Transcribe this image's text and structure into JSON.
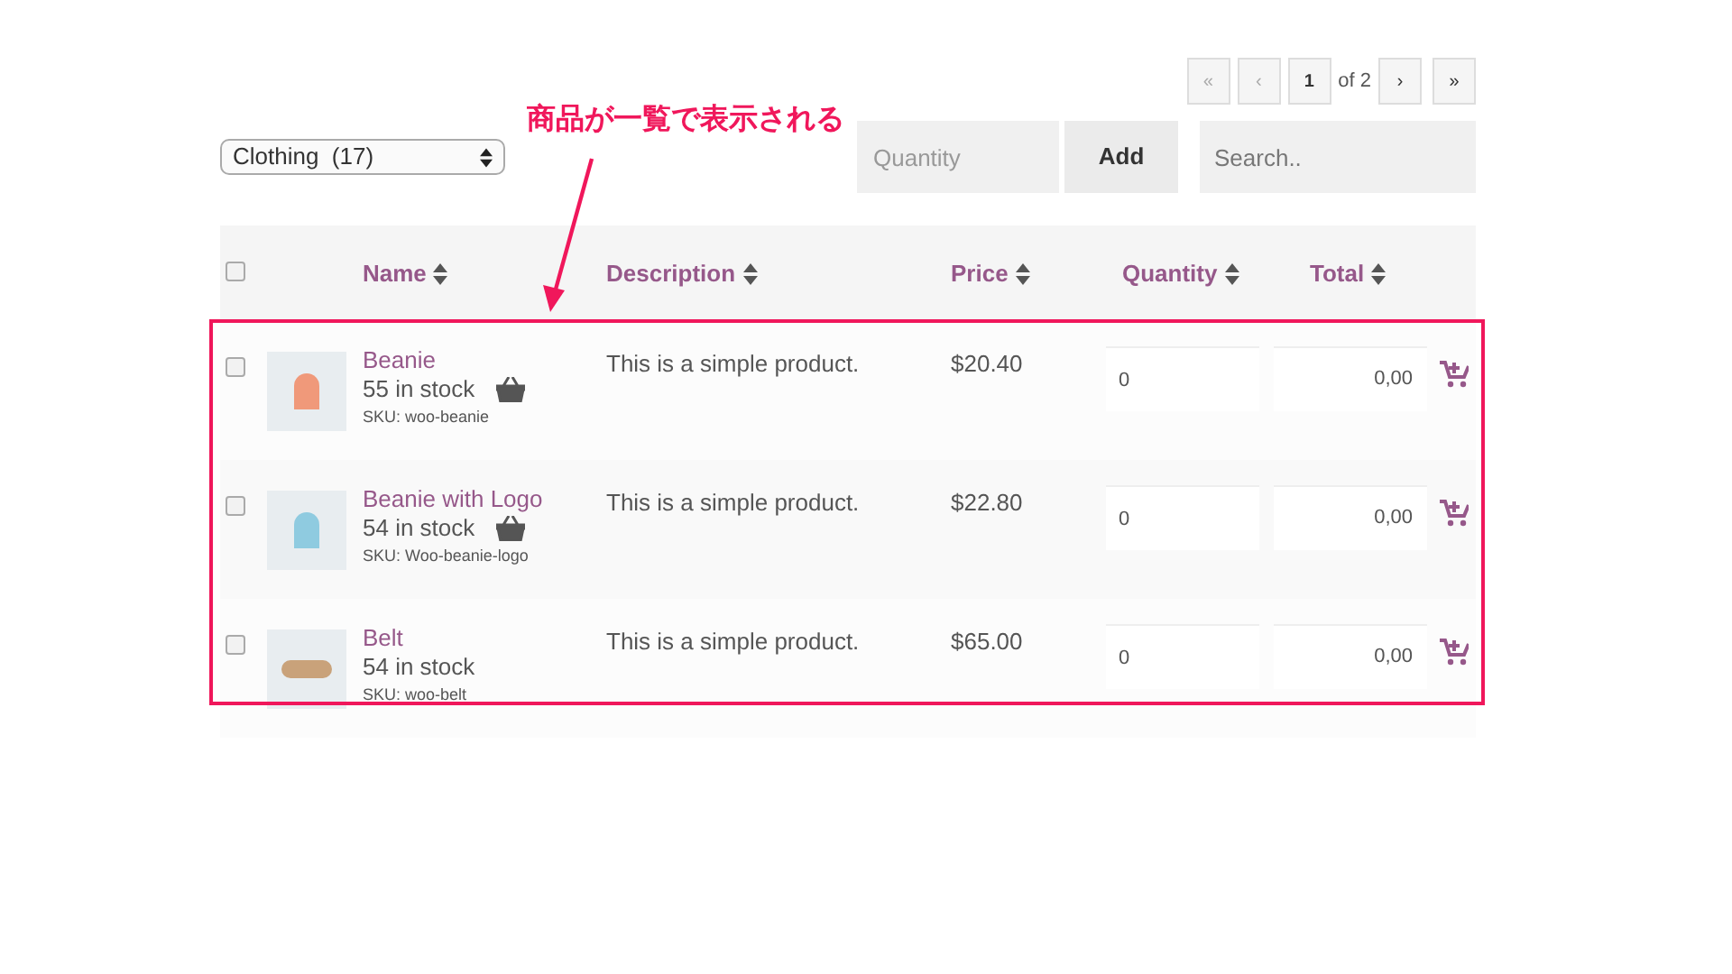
{
  "pagination": {
    "first": "«",
    "prev": "‹",
    "page": "1",
    "of": "of 2",
    "next": "›",
    "last": "»"
  },
  "category_select": {
    "value": "Clothing  (17)"
  },
  "quantity_field": {
    "placeholder": "Quantity"
  },
  "add_button": "Add",
  "search": {
    "placeholder": "Search.."
  },
  "table": {
    "select_all": {
      "checked": false
    },
    "columns": [
      "Name",
      "Description",
      "Price",
      "Quantity",
      "Total"
    ],
    "rows": [
      {
        "checked": false,
        "name": "Beanie",
        "stock": "55 in stock",
        "basket": true,
        "sku": "SKU: woo-beanie",
        "description": "This is a simple product.",
        "price": "$20.40",
        "quantity": "0",
        "total": "0,00",
        "kind": "beanie"
      },
      {
        "checked": false,
        "name": "Beanie with Logo",
        "stock": "54 in stock",
        "basket": true,
        "sku": "SKU: Woo-beanie-logo",
        "description": "This is a simple product.",
        "price": "$22.80",
        "quantity": "0",
        "total": "0,00",
        "kind": "beanie"
      },
      {
        "checked": false,
        "name": "Belt",
        "stock": "54 in stock",
        "basket": false,
        "sku": "SKU: woo-belt",
        "description": "This is a simple product.",
        "price": "$65.00",
        "quantity": "0",
        "total": "0,00",
        "kind": "belt"
      }
    ]
  },
  "annotation": {
    "text": "商品が一覧で表示される"
  }
}
